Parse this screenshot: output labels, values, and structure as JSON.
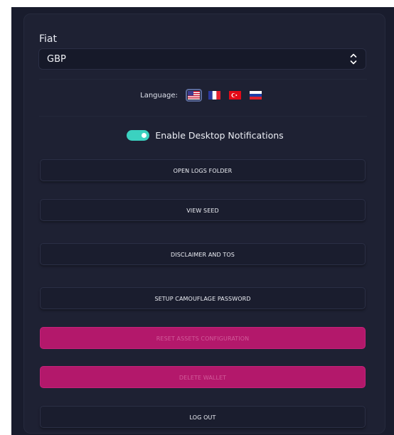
{
  "settings": {
    "fiat_label": "Fiat",
    "fiat_value": "GBP",
    "language_label": "Language:",
    "languages": [
      {
        "name": "English",
        "icon": "us-flag-icon",
        "selected": true
      },
      {
        "name": "French",
        "icon": "france-flag-icon",
        "selected": false
      },
      {
        "name": "Turkish",
        "icon": "turkey-flag-icon",
        "selected": false
      },
      {
        "name": "Russian",
        "icon": "russia-flag-icon",
        "selected": false
      }
    ],
    "notifications_label": "Enable Desktop Notifications",
    "notifications_enabled": true
  },
  "buttons": {
    "open_logs": "OPEN LOGS FOLDER",
    "view_seed": "VIEW SEED",
    "disclaimer": "DISCLAIMER AND TOS",
    "camouflage": "SETUP CAMOUFLAGE PASSWORD",
    "reset_assets": "RESET ASSETS CONFIGURATION",
    "delete_wallet": "DELETE WALLET",
    "log_out": "LOG OUT"
  },
  "colors": {
    "background": "#191c2d",
    "panel": "#1e2133",
    "accent_toggle": "#3bd1c0",
    "danger": "#b3186b"
  }
}
